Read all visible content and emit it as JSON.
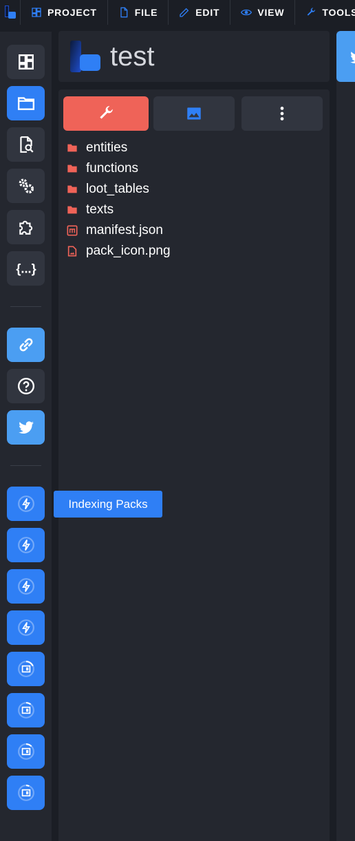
{
  "menu": {
    "items": [
      {
        "label": "PROJECT",
        "icon": "dashboard-icon"
      },
      {
        "label": "FILE",
        "icon": "file-icon"
      },
      {
        "label": "EDIT",
        "icon": "pencil-icon"
      },
      {
        "label": "VIEW",
        "icon": "eye-icon"
      },
      {
        "label": "TOOLS",
        "icon": "wrench-icon"
      }
    ]
  },
  "sidebar": {
    "buttons": [
      {
        "name": "dashboard",
        "icon": "dashboard-icon"
      },
      {
        "name": "packs",
        "icon": "folder-icon",
        "active": true
      },
      {
        "name": "file-search",
        "icon": "file-search-icon"
      },
      {
        "name": "settings",
        "icon": "cogs-icon"
      },
      {
        "name": "extensions",
        "icon": "puzzle-icon"
      },
      {
        "name": "snippets",
        "icon": "braces-icon"
      },
      {
        "name": "link",
        "icon": "link-icon"
      },
      {
        "name": "help",
        "icon": "help-icon"
      },
      {
        "name": "twitter",
        "icon": "twitter-icon"
      }
    ],
    "tasks": [
      {
        "icon": "lightning-icon"
      },
      {
        "icon": "lightning-icon"
      },
      {
        "icon": "lightning-icon"
      },
      {
        "icon": "lightning-icon"
      },
      {
        "icon": "pack-icon"
      },
      {
        "icon": "pack-icon"
      },
      {
        "icon": "pack-icon"
      },
      {
        "icon": "pack-icon"
      }
    ]
  },
  "explorer": {
    "project_name": "test",
    "tabs": [
      {
        "name": "pack-explorer",
        "icon": "wrench-icon"
      },
      {
        "name": "resource-pack",
        "icon": "image-icon"
      },
      {
        "name": "more-options",
        "icon": "dots-vertical-icon"
      }
    ],
    "files": [
      {
        "name": "entities",
        "type": "folder"
      },
      {
        "name": "functions",
        "type": "folder"
      },
      {
        "name": "loot_tables",
        "type": "folder"
      },
      {
        "name": "texts",
        "type": "folder"
      },
      {
        "name": "manifest.json",
        "type": "json"
      },
      {
        "name": "pack_icon.png",
        "type": "image"
      }
    ]
  },
  "tooltip": {
    "text": "Indexing Packs"
  },
  "colors": {
    "accent": "#2f7ff5",
    "red": "#ef6358",
    "twitter": "#4b9ef2",
    "background": "#1b1e25",
    "panel": "#24272f",
    "button": "#31353f"
  }
}
